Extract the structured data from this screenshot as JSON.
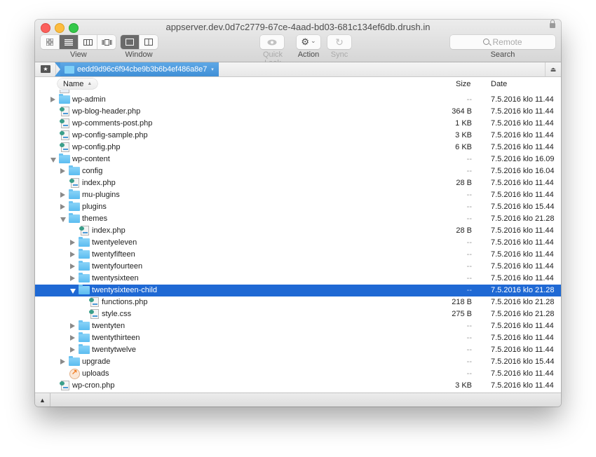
{
  "window": {
    "title": "appserver.dev.0d7c2779-67ce-4aad-bd03-681c134ef6db.drush.in"
  },
  "toolbar": {
    "view_label": "View",
    "window_label": "Window",
    "quicklook_label": "Quick Look",
    "action_label": "Action",
    "sync_label": "Sync",
    "search_label": "Search",
    "search_placeholder": "Remote",
    "view_modes": [
      "icon",
      "list",
      "column",
      "cover-flow"
    ],
    "active_view": "list",
    "window_modes": [
      "single-pane",
      "dual-pane"
    ],
    "active_window": "single-pane"
  },
  "pathbar": {
    "current_folder": "eedd9d96c6f94cbe9b3b6b4ef486a8e7"
  },
  "columns": {
    "name": "Name",
    "size": "Size",
    "date": "Date"
  },
  "files": [
    {
      "name": "wp-admin",
      "type": "folder",
      "level": 0,
      "expanded": false,
      "size": "--",
      "date": "7.5.2016 klo 11.44"
    },
    {
      "name": "wp-blog-header.php",
      "type": "file",
      "level": 0,
      "size": "364 B",
      "date": "7.5.2016 klo 11.44"
    },
    {
      "name": "wp-comments-post.php",
      "type": "file",
      "level": 0,
      "size": "1 KB",
      "date": "7.5.2016 klo 11.44"
    },
    {
      "name": "wp-config-sample.php",
      "type": "file",
      "level": 0,
      "size": "3 KB",
      "date": "7.5.2016 klo 11.44"
    },
    {
      "name": "wp-config.php",
      "type": "file",
      "level": 0,
      "size": "6 KB",
      "date": "7.5.2016 klo 11.44"
    },
    {
      "name": "wp-content",
      "type": "folder",
      "level": 0,
      "expanded": true,
      "size": "--",
      "date": "7.5.2016 klo 16.09"
    },
    {
      "name": "config",
      "type": "folder",
      "level": 1,
      "expanded": false,
      "size": "--",
      "date": "7.5.2016 klo 16.04"
    },
    {
      "name": "index.php",
      "type": "file",
      "level": 1,
      "size": "28 B",
      "date": "7.5.2016 klo 11.44"
    },
    {
      "name": "mu-plugins",
      "type": "folder",
      "level": 1,
      "expanded": false,
      "size": "--",
      "date": "7.5.2016 klo 11.44"
    },
    {
      "name": "plugins",
      "type": "folder",
      "level": 1,
      "expanded": false,
      "size": "--",
      "date": "7.5.2016 klo 15.44"
    },
    {
      "name": "themes",
      "type": "folder",
      "level": 1,
      "expanded": true,
      "size": "--",
      "date": "7.5.2016 klo 21.28"
    },
    {
      "name": "index.php",
      "type": "file",
      "level": 2,
      "size": "28 B",
      "date": "7.5.2016 klo 11.44"
    },
    {
      "name": "twentyeleven",
      "type": "folder",
      "level": 2,
      "expanded": false,
      "size": "--",
      "date": "7.5.2016 klo 11.44"
    },
    {
      "name": "twentyfifteen",
      "type": "folder",
      "level": 2,
      "expanded": false,
      "size": "--",
      "date": "7.5.2016 klo 11.44"
    },
    {
      "name": "twentyfourteen",
      "type": "folder",
      "level": 2,
      "expanded": false,
      "size": "--",
      "date": "7.5.2016 klo 11.44"
    },
    {
      "name": "twentysixteen",
      "type": "folder",
      "level": 2,
      "expanded": false,
      "size": "--",
      "date": "7.5.2016 klo 11.44"
    },
    {
      "name": "twentysixteen-child",
      "type": "folder",
      "level": 2,
      "expanded": true,
      "selected": true,
      "size": "--",
      "date": "7.5.2016 klo 21.28"
    },
    {
      "name": "functions.php",
      "type": "file",
      "level": 3,
      "size": "218 B",
      "date": "7.5.2016 klo 21.28"
    },
    {
      "name": "style.css",
      "type": "file",
      "level": 3,
      "size": "275 B",
      "date": "7.5.2016 klo 21.28"
    },
    {
      "name": "twentyten",
      "type": "folder",
      "level": 2,
      "expanded": false,
      "size": "--",
      "date": "7.5.2016 klo 11.44"
    },
    {
      "name": "twentythirteen",
      "type": "folder",
      "level": 2,
      "expanded": false,
      "size": "--",
      "date": "7.5.2016 klo 11.44"
    },
    {
      "name": "twentytwelve",
      "type": "folder",
      "level": 2,
      "expanded": false,
      "size": "--",
      "date": "7.5.2016 klo 11.44"
    },
    {
      "name": "upgrade",
      "type": "folder",
      "level": 1,
      "expanded": false,
      "size": "--",
      "date": "7.5.2016 klo 15.44"
    },
    {
      "name": "uploads",
      "type": "alias",
      "level": 1,
      "size": "--",
      "date": "7.5.2016 klo 11.44"
    },
    {
      "name": "wp-cron.php",
      "type": "file",
      "level": 0,
      "size": "3 KB",
      "date": "7.5.2016 klo 11.44"
    }
  ],
  "icons": {
    "eye": "👁",
    "gear": "⚙",
    "chevron": "⌄",
    "sync": "↻",
    "star": "★",
    "eject": "⏏",
    "sort_up": "▲",
    "toggle_up": "▲",
    "dropdown": "▾"
  }
}
